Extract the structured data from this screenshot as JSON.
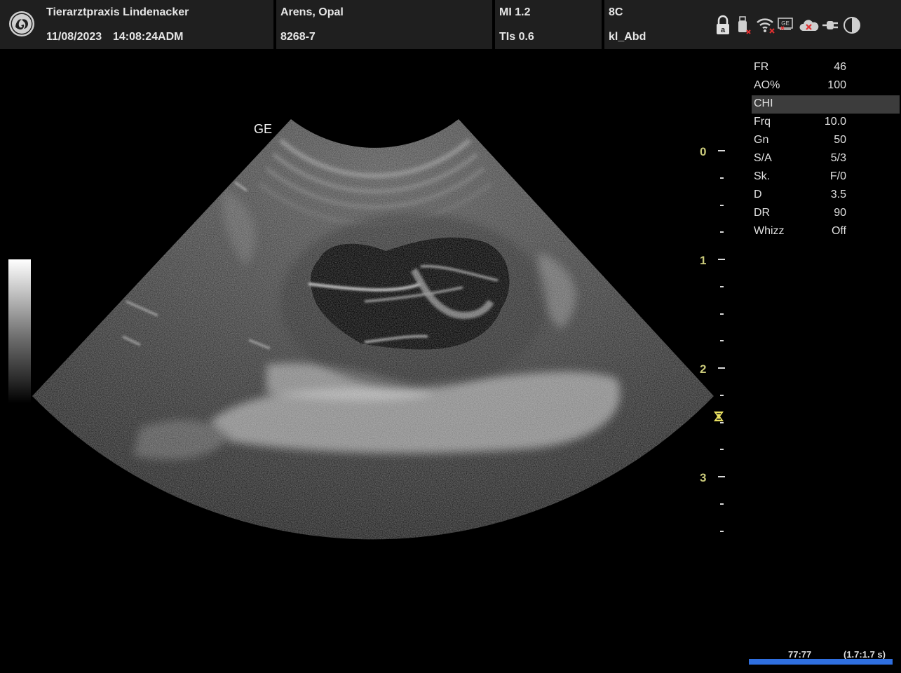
{
  "header": {
    "clinic_name": "Tierarztpraxis Lindenacker",
    "date": "11/08/2023",
    "time_user": "14:08:24ADM",
    "patient_name": "Arens, Opal",
    "patient_id": "8268-7",
    "mi": "MI 1.2",
    "tis": "TIs 0.6",
    "probe": "8C",
    "preset": "kl_Abd"
  },
  "status_icons": [
    "lock-icon",
    "usb-error-icon",
    "wifi-error-icon",
    "network-error-icon",
    "cloud-error-icon",
    "power-plug-icon",
    "contrast-icon"
  ],
  "image": {
    "orientation_mark": "GE"
  },
  "depth_scale": {
    "labels": [
      "0",
      "1",
      "2",
      "3"
    ],
    "unit": "cm",
    "focus_depth_cm": 2.45
  },
  "parameters": [
    {
      "name": "FR",
      "value": "46"
    },
    {
      "name": "AO%",
      "value": "100"
    },
    {
      "name": "CHI",
      "value": "",
      "highlight": true
    },
    {
      "name": "Frq",
      "value": "10.0"
    },
    {
      "name": "Gn",
      "value": "50"
    },
    {
      "name": "S/A",
      "value": "5/3"
    },
    {
      "name": "Sk.",
      "value": "F/0"
    },
    {
      "name": "D",
      "value": "3.5"
    },
    {
      "name": "DR",
      "value": "90"
    },
    {
      "name": "Whizz",
      "value": "Off"
    }
  ],
  "cine": {
    "frames": "77:77",
    "time": "(1.7:1.7 s)",
    "progress": 1.0
  },
  "colors": {
    "header_bg": "#1f1f1f",
    "depth_label": "#c9c97a",
    "focus_marker": "#e8e060",
    "cine_bar": "#2f6fe0"
  }
}
